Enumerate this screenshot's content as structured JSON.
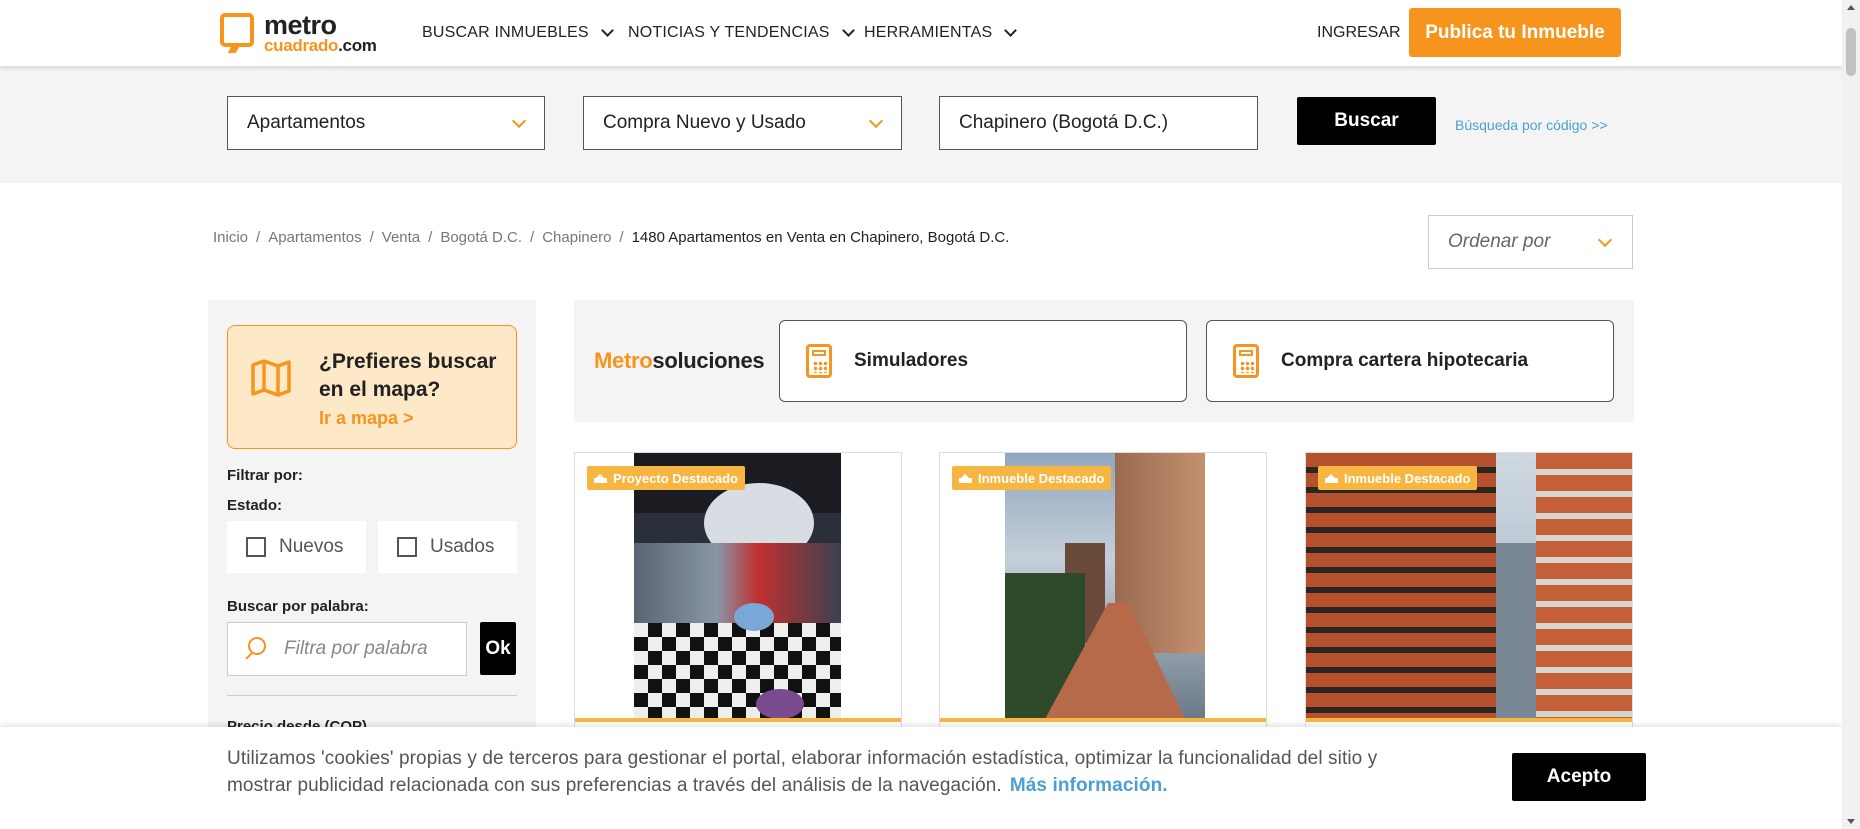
{
  "header": {
    "logo_main": "metro",
    "logo_sub_a": "cuadrado",
    "logo_sub_b": ".com",
    "nav": [
      {
        "label": "BUSCAR INMUEBLES",
        "icon": "chevron-down-icon"
      },
      {
        "label": "NOTICIAS Y TENDENCIAS",
        "icon": "chevron-down-icon"
      },
      {
        "label": "HERRAMIENTAS",
        "icon": "chevron-down-icon"
      }
    ],
    "login_label": "INGRESAR",
    "publish_label": "Publica tu Inmueble"
  },
  "search": {
    "property_type": "Apartamentos",
    "operation": "Compra Nuevo y Usado",
    "location": "Chapinero (Bogotá D.C.)",
    "button_label": "Buscar",
    "code_link": "Búsqueda por código >>"
  },
  "breadcrumb": {
    "items": [
      "Inicio",
      "Apartamentos",
      "Venta",
      "Bogotá D.C.",
      "Chapinero"
    ],
    "current": "1480 Apartamentos en Venta en Chapinero, Bogotá D.C."
  },
  "sort": {
    "placeholder": "Ordenar por"
  },
  "sidebar": {
    "map_question": "¿Prefieres buscar en el mapa?",
    "map_link": "Ir a mapa >",
    "filter_by": "Filtrar por:",
    "estado_label": "Estado:",
    "estado_options": [
      "Nuevos",
      "Usados"
    ],
    "word_label": "Buscar por palabra:",
    "word_placeholder": "Filtra por palabra",
    "ok_label": "Ok",
    "price_label": "Precio desde (COP)"
  },
  "solutions": {
    "title_a": "Metro",
    "title_b": "soluciones",
    "cards": [
      {
        "label": "Simuladores",
        "icon": "calculator-icon"
      },
      {
        "label": "Compra cartera hipotecaria",
        "icon": "calculator-icon"
      }
    ]
  },
  "listings": [
    {
      "badge": "Proyecto Destacado",
      "image": "office-lounge-photo"
    },
    {
      "badge": "Inmueble Destacado",
      "image": "walkway-photo"
    },
    {
      "badge": "Inmueble Destacado",
      "image": "brick-tower-photo"
    }
  ],
  "cookie": {
    "text": "Utilizamos 'cookies' propias y de terceros para gestionar el portal, elaborar información estadística, optimizar la funcionalidad del sitio y mostrar publicidad relacionada con sus preferencias a través del análisis de la navegación.",
    "more_link": "Más información.",
    "accept_label": "Acepto"
  },
  "colors": {
    "brand_orange": "#f7941d",
    "badge_yellow": "#f7b642",
    "link_blue": "#4b9fd5",
    "map_card_bg": "#fde9c7"
  }
}
